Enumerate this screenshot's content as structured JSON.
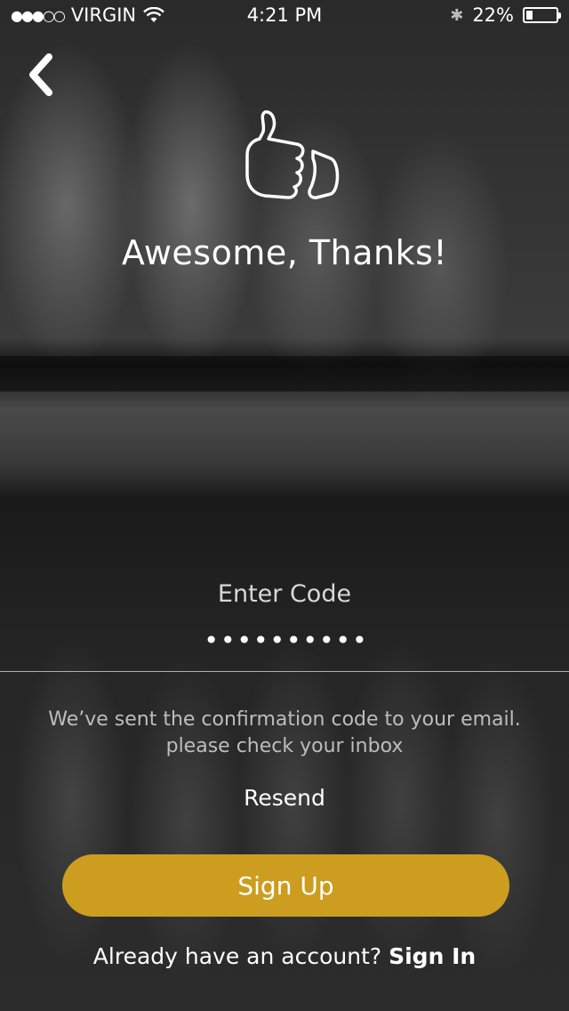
{
  "status_bar": {
    "signal": "●●●○○",
    "carrier": "VIRGIN",
    "time": "4:21 PM",
    "bluetooth": "✱",
    "battery_percent": "22%",
    "battery_level": 0.22
  },
  "header": {
    "back_icon": "chevron-left-icon",
    "thumbs_icon": "thumbs-up-icon",
    "title": "Awesome, Thanks!"
  },
  "form": {
    "code_label": "Enter Code",
    "code_value": "••••••••••",
    "info_line1": "We’ve sent the confirmation code to your email.",
    "info_line2": "please check your inbox",
    "resend_label": "Resend",
    "signup_label": "Sign Up"
  },
  "footer": {
    "prompt": "Already have an account?",
    "signin_label": "Sign In"
  },
  "colors": {
    "accent": "#cc9d1f"
  }
}
